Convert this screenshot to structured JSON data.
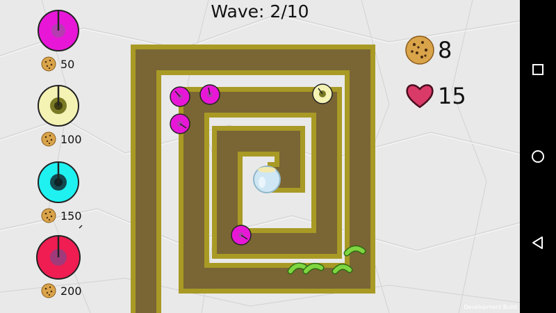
{
  "hud": {
    "wave_label": "Wave: 2/10",
    "cookies": "8",
    "lives": "15"
  },
  "shop": [
    {
      "name": "magenta-tower",
      "price": "50",
      "color": "#e817d8",
      "ring": "#b43db0"
    },
    {
      "name": "yellow-tower",
      "price": "100",
      "color": "#f4f3b4",
      "ring": "#7a7a25"
    },
    {
      "name": "cyan-tower",
      "price": "150",
      "color": "#1ff1f1",
      "ring": "#134a50"
    },
    {
      "name": "red-tower",
      "price": "200",
      "color": "#ef1d52",
      "ring": "#a03a7a"
    }
  ],
  "placed_towers": [
    {
      "type": "magenta-tower"
    },
    {
      "type": "magenta-tower"
    },
    {
      "type": "magenta-tower"
    },
    {
      "type": "yellow-tower"
    },
    {
      "type": "magenta-tower"
    }
  ],
  "enemies": [
    {
      "type": "green-worm"
    },
    {
      "type": "green-worm"
    },
    {
      "type": "green-worm"
    },
    {
      "type": "green-worm"
    }
  ],
  "colors": {
    "path_fill": "#7a6535",
    "path_border": "#a89a25",
    "paper": "#e9e9e9",
    "heart": "#d93a68",
    "cookie": "#d9a44a",
    "worm": "#7fd640"
  },
  "icons": {
    "cookie": "cookie-icon",
    "heart": "heart-icon",
    "nav_recents": "square-icon",
    "nav_home": "circle-icon",
    "nav_back": "triangle-back-icon"
  },
  "footer": {
    "dev_build": "Development Build"
  }
}
